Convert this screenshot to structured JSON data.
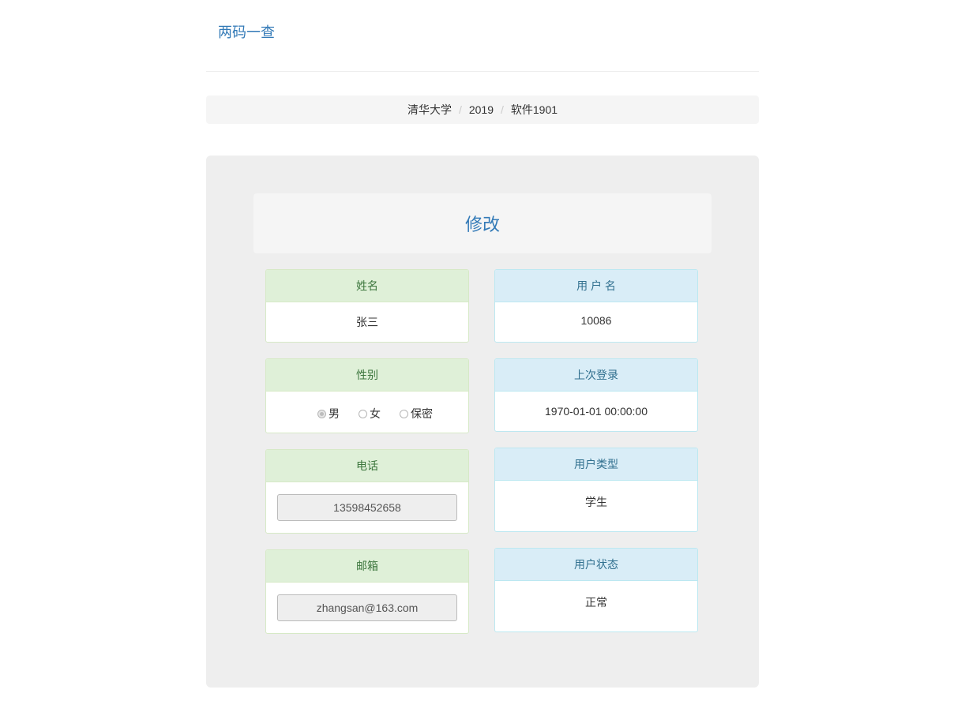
{
  "header": {
    "brand": "两码一查"
  },
  "breadcrumb": {
    "items": [
      "清华大学",
      "2019",
      "软件1901"
    ],
    "separator": "/"
  },
  "form": {
    "title": "修改",
    "name": {
      "label": "姓名",
      "value": "张三"
    },
    "username": {
      "label": "用 户 名",
      "value": "10086"
    },
    "gender": {
      "label": "性别",
      "options": [
        "男",
        "女",
        "保密"
      ],
      "selected": "男"
    },
    "last_login": {
      "label": "上次登录",
      "value": "1970-01-01 00:00:00"
    },
    "phone": {
      "label": "电话",
      "value": "13598452658"
    },
    "user_type": {
      "label": "用户类型",
      "value": "学生"
    },
    "email": {
      "label": "邮箱",
      "value": "zhangsan@163.com"
    },
    "user_status": {
      "label": "用户状态",
      "value": "正常"
    }
  },
  "colors": {
    "brand": "#337ab7",
    "green_header_bg": "#dff0d8",
    "green_header_text": "#3c763d",
    "blue_header_bg": "#d9edf7",
    "blue_header_text": "#31708f"
  }
}
